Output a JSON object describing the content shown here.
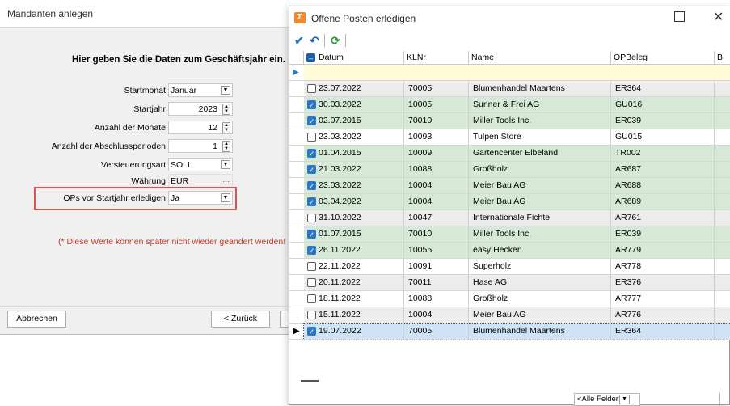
{
  "background_dialog": {
    "title": "Mandanten anlegen",
    "heading": "Hier geben Sie die Daten zum Geschäftsjahr ein.",
    "fields": [
      {
        "label": "Startmonat",
        "value": "Januar",
        "kind": "dropdown"
      },
      {
        "label": "Startjahr",
        "value": "2023",
        "kind": "spinner"
      },
      {
        "label": "Anzahl der Monate",
        "value": "12",
        "kind": "spinner"
      },
      {
        "label": "Anzahl der Abschlussperioden",
        "value": "1",
        "kind": "spinner"
      },
      {
        "label": "Versteuerungsart",
        "value": "SOLL",
        "kind": "dropdown"
      },
      {
        "label": "Währung",
        "value": "EUR",
        "kind": "picker",
        "button": "..."
      },
      {
        "label": "OPs vor Startjahr erledigen",
        "value": "Ja",
        "kind": "dropdown"
      }
    ],
    "note": "(* Diese Werte können später nicht wieder geändert werden!",
    "cancel_label": "Abbrechen",
    "back_label": "< Zurück"
  },
  "window": {
    "title": "Offene Posten erledigen",
    "toolbar": {
      "check_icon": "checkmark-icon",
      "undo_icon": "undo-icon",
      "refresh_icon": "refresh-icon"
    },
    "columns": [
      "Datum",
      "KLNr",
      "Name",
      "OPBeleg",
      "B"
    ],
    "rows": [
      {
        "checked": false,
        "date": "23.07.2022",
        "klnr": "70005",
        "name": "Blumenhandel  Maartens",
        "opbeleg": "ER364"
      },
      {
        "checked": true,
        "date": "30.03.2022",
        "klnr": "10005",
        "name": "Sunner & Frei AG",
        "opbeleg": "GU016"
      },
      {
        "checked": true,
        "date": "02.07.2015",
        "klnr": "70010",
        "name": "Miller Tools Inc.",
        "opbeleg": "ER039"
      },
      {
        "checked": false,
        "date": "23.03.2022",
        "klnr": "10093",
        "name": "Tulpen Store",
        "opbeleg": "GU015"
      },
      {
        "checked": true,
        "date": "01.04.2015",
        "klnr": "10009",
        "name": "Gartencenter Elbeland",
        "opbeleg": "TR002"
      },
      {
        "checked": true,
        "date": "21.03.2022",
        "klnr": "10088",
        "name": "Großholz",
        "opbeleg": "AR687"
      },
      {
        "checked": true,
        "date": "23.03.2022",
        "klnr": "10004",
        "name": "Meier Bau AG",
        "opbeleg": "AR688"
      },
      {
        "checked": true,
        "date": "03.04.2022",
        "klnr": "10004",
        "name": "Meier Bau AG",
        "opbeleg": "AR689"
      },
      {
        "checked": false,
        "date": "31.10.2022",
        "klnr": "10047",
        "name": "Internationale Fichte",
        "opbeleg": "AR761"
      },
      {
        "checked": true,
        "date": "01.07.2015",
        "klnr": "70010",
        "name": "Miller Tools Inc.",
        "opbeleg": "ER039"
      },
      {
        "checked": true,
        "date": "26.11.2022",
        "klnr": "10055",
        "name": "easy Hecken",
        "opbeleg": "AR779"
      },
      {
        "checked": false,
        "date": "22.11.2022",
        "klnr": "10091",
        "name": "Superholz",
        "opbeleg": "AR778"
      },
      {
        "checked": false,
        "date": "20.11.2022",
        "klnr": "70011",
        "name": "Hase AG",
        "opbeleg": "ER376"
      },
      {
        "checked": false,
        "date": "18.11.2022",
        "klnr": "10088",
        "name": "Großholz",
        "opbeleg": "AR777"
      },
      {
        "checked": false,
        "date": "15.11.2022",
        "klnr": "10004",
        "name": "Meier Bau AG",
        "opbeleg": "AR776"
      },
      {
        "checked": true,
        "date": "19.07.2022",
        "klnr": "70005",
        "name": "Blumenhandel  Maartens",
        "opbeleg": "ER364",
        "current": true
      }
    ],
    "filter_label": "<Alle Felder>"
  },
  "colors": {
    "checked_row": "#d6e9d6",
    "unchecked_row_alt": "#ececec",
    "current_row": "#cfe3f7",
    "filter_row": "#fffbd9",
    "highlight_border": "#e05050",
    "note_color": "#c0392b",
    "accent": "#2a78c7"
  }
}
